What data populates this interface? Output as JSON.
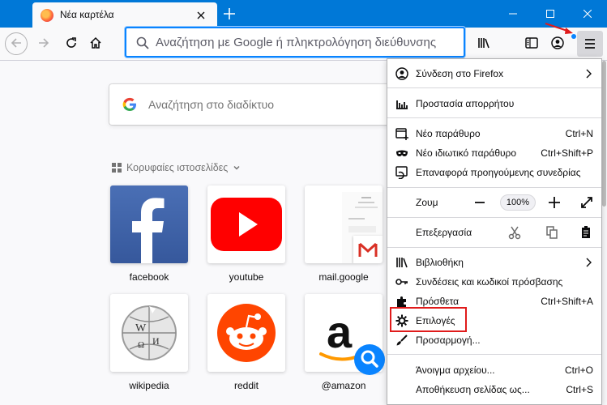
{
  "window": {
    "tab_title": "Νέα καρτέλα"
  },
  "urlbar": {
    "placeholder": "Αναζήτηση με Google ή πληκτρολόγηση διεύθυνσης"
  },
  "newtab": {
    "search_placeholder": "Αναζήτηση στο διαδίκτυο",
    "top_sites_heading": "Κορυφαίες ιστοσελίδες",
    "tiles": [
      {
        "label": "facebook"
      },
      {
        "label": "youtube"
      },
      {
        "label": "mail.google"
      },
      {
        "label": "wikipedia"
      },
      {
        "label": "reddit"
      },
      {
        "label": "@amazon"
      }
    ]
  },
  "menu": {
    "signin": "Σύνδεση στο Firefox",
    "privacy": "Προστασία απορρήτου",
    "new_window": "Νέο παράθυρο",
    "new_window_shortcut": "Ctrl+N",
    "private_window": "Νέο ιδιωτικό παράθυρο",
    "private_window_shortcut": "Ctrl+Shift+P",
    "restore_session": "Επαναφορά προηγούμενης συνεδρίας",
    "zoom_label": "Ζουμ",
    "zoom_value": "100%",
    "edit_label": "Επεξεργασία",
    "library": "Βιβλιοθήκη",
    "logins": "Συνδέσεις και κωδικοί πρόσβασης",
    "addons": "Πρόσθετα",
    "addons_shortcut": "Ctrl+Shift+A",
    "options": "Επιλογές",
    "customize": "Προσαρμογή...",
    "open_file": "Άνοιγμα αρχείου...",
    "open_file_shortcut": "Ctrl+O",
    "save_page": "Αποθήκευση σελίδας ως...",
    "save_page_shortcut": "Ctrl+S"
  },
  "colors": {
    "titlebar": "#0078d7",
    "accent": "#0a84ff",
    "annotation": "#e01b1b"
  }
}
